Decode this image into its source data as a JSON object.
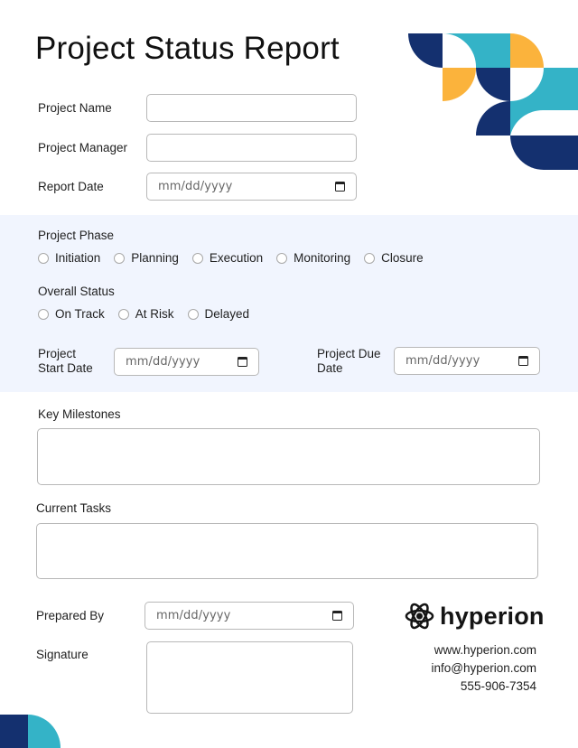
{
  "title": "Project Status Report",
  "colors": {
    "navy": "#14306f",
    "teal": "#34b3c7",
    "amber": "#fbb33c",
    "band_bg": "#f1f5fe"
  },
  "fields": {
    "project_name": {
      "label": "Project Name",
      "value": ""
    },
    "project_manager": {
      "label": "Project Manager",
      "value": ""
    },
    "report_date": {
      "label": "Report Date",
      "placeholder": "mm/dd/yyyy",
      "icon": "calendar-icon"
    }
  },
  "phase": {
    "label": "Project Phase",
    "options": [
      "Initiation",
      "Planning",
      "Execution",
      "Monitoring",
      "Closure"
    ]
  },
  "status": {
    "label": "Overall Status",
    "options": [
      "On Track",
      "At Risk",
      "Delayed"
    ]
  },
  "dates": {
    "start": {
      "label": "Project Start Date",
      "placeholder": "mm/dd/yyyy"
    },
    "due": {
      "label": "Project Due Date",
      "placeholder": "mm/dd/yyyy"
    }
  },
  "milestones": {
    "label": "Key Milestones",
    "value": ""
  },
  "tasks": {
    "label": "Current Tasks",
    "value": ""
  },
  "prepared_by": {
    "label": "Prepared By",
    "placeholder": "mm/dd/yyyy"
  },
  "signature": {
    "label": "Signature",
    "value": ""
  },
  "brand": {
    "name": "hyperion",
    "icon": "atom-icon",
    "website": "www.hyperion.com",
    "email": "info@hyperion.com",
    "phone": "555-906-7354"
  }
}
